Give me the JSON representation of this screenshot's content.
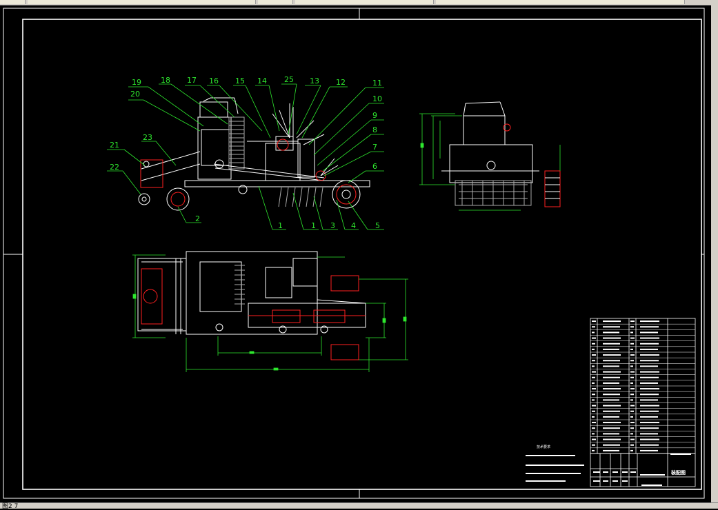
{
  "window": {
    "status_text": "图2 7"
  },
  "drawing": {
    "colors": {
      "background": "#000000",
      "frame": "#ffffff",
      "leader": "#2ee82e",
      "dimension": "#2ee82e",
      "accent": "#ff2020"
    },
    "balloons": [
      {
        "id": "b19",
        "text": "19"
      },
      {
        "id": "b18",
        "text": "18"
      },
      {
        "id": "b17",
        "text": "17"
      },
      {
        "id": "b16",
        "text": "16"
      },
      {
        "id": "b15",
        "text": "15"
      },
      {
        "id": "b14",
        "text": "14"
      },
      {
        "id": "b25",
        "text": "25"
      },
      {
        "id": "b13",
        "text": "13"
      },
      {
        "id": "b12",
        "text": "12"
      },
      {
        "id": "b11",
        "text": "11"
      },
      {
        "id": "b20",
        "text": "20"
      },
      {
        "id": "b10",
        "text": "10"
      },
      {
        "id": "b9",
        "text": "9"
      },
      {
        "id": "b8",
        "text": "8"
      },
      {
        "id": "b23",
        "text": "23"
      },
      {
        "id": "b7",
        "text": "7"
      },
      {
        "id": "b21",
        "text": "21"
      },
      {
        "id": "b6",
        "text": "6"
      },
      {
        "id": "b22",
        "text": "22"
      },
      {
        "id": "b2",
        "text": "2"
      },
      {
        "id": "b1a",
        "text": "1"
      },
      {
        "id": "b1b",
        "text": "1"
      },
      {
        "id": "b3",
        "text": "3"
      },
      {
        "id": "b4",
        "text": "4"
      },
      {
        "id": "b5",
        "text": "5"
      }
    ],
    "technical_requirements": {
      "heading": "技术要求"
    },
    "title_block": {
      "name": "装配图"
    }
  }
}
